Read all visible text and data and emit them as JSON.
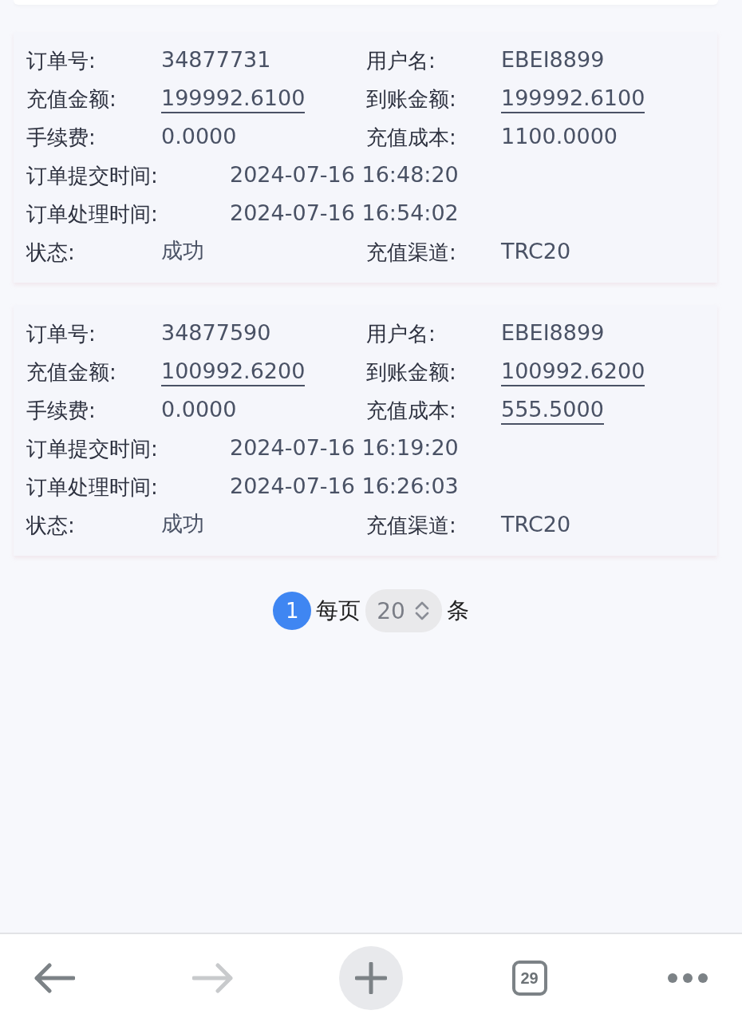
{
  "orders": [
    {
      "rows": [
        {
          "kind": "pair",
          "fields": [
            {
              "label": "订单号:",
              "value": "34877731",
              "underlined": false
            },
            {
              "label": "用户名:",
              "value": "EBEI8899",
              "underlined": false
            }
          ]
        },
        {
          "kind": "pair",
          "fields": [
            {
              "label": "充值金额:",
              "value": "199992.6100",
              "underlined": true
            },
            {
              "label": "到账金额:",
              "value": "199992.6100",
              "underlined": true
            }
          ]
        },
        {
          "kind": "pair",
          "fields": [
            {
              "label": "手续费:",
              "value": "0.0000",
              "underlined": false
            },
            {
              "label": "充值成本:",
              "value": "1100.0000",
              "underlined": false
            }
          ]
        },
        {
          "kind": "single",
          "fields": [
            {
              "label": "订单提交时间:",
              "value": "2024-07-16 16:48:20",
              "underlined": false
            }
          ]
        },
        {
          "kind": "single",
          "fields": [
            {
              "label": "订单处理时间:",
              "value": "2024-07-16 16:54:02",
              "underlined": false
            }
          ]
        },
        {
          "kind": "pair",
          "fields": [
            {
              "label": "状态:",
              "value": "成功",
              "underlined": false
            },
            {
              "label": "充值渠道:",
              "value": "TRC20",
              "underlined": false
            }
          ]
        }
      ]
    },
    {
      "rows": [
        {
          "kind": "pair",
          "fields": [
            {
              "label": "订单号:",
              "value": "34877590",
              "underlined": false
            },
            {
              "label": "用户名:",
              "value": "EBEI8899",
              "underlined": false
            }
          ]
        },
        {
          "kind": "pair",
          "fields": [
            {
              "label": "充值金额:",
              "value": "100992.6200",
              "underlined": true
            },
            {
              "label": "到账金额:",
              "value": "100992.6200",
              "underlined": true
            }
          ]
        },
        {
          "kind": "pair",
          "fields": [
            {
              "label": "手续费:",
              "value": "0.0000",
              "underlined": false
            },
            {
              "label": "充值成本:",
              "value": "555.5000",
              "underlined": true
            }
          ]
        },
        {
          "kind": "single",
          "fields": [
            {
              "label": "订单提交时间:",
              "value": "2024-07-16 16:19:20",
              "underlined": false
            }
          ]
        },
        {
          "kind": "single",
          "fields": [
            {
              "label": "订单处理时间:",
              "value": "2024-07-16 16:26:03",
              "underlined": false
            }
          ]
        },
        {
          "kind": "pair",
          "fields": [
            {
              "label": "状态:",
              "value": "成功",
              "underlined": false
            },
            {
              "label": "充值渠道:",
              "value": "TRC20",
              "underlined": false
            }
          ]
        }
      ]
    }
  ],
  "pagination": {
    "pages": [
      {
        "label": "1",
        "selected": true
      }
    ],
    "per_page_prefix": "每页",
    "page_size": "20",
    "per_page_suffix": "条"
  },
  "browser_bar": {
    "back_disabled": false,
    "forward_disabled": true,
    "tab_count": "29"
  }
}
